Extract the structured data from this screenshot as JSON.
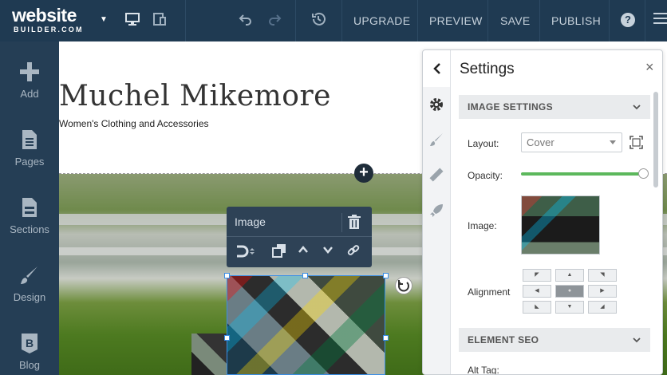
{
  "topbar": {
    "logo_line1": "website",
    "logo_line2": "BUILDER.COM",
    "upgrade_label": "UPGRADE",
    "preview_label": "PREVIEW",
    "save_label": "SAVE",
    "publish_label": "PUBLISH",
    "help_label": "?",
    "background_color": "#1f3a52"
  },
  "sidebar": {
    "items": [
      {
        "label": "Add",
        "icon": "plus-icon"
      },
      {
        "label": "Pages",
        "icon": "page-icon"
      },
      {
        "label": "Sections",
        "icon": "sections-icon"
      },
      {
        "label": "Design",
        "icon": "brush-icon"
      },
      {
        "label": "Blog",
        "icon": "blog-icon"
      }
    ]
  },
  "canvas": {
    "site_title": "Muchel Mikemore",
    "site_subtitle": "Women's Clothing and Accessories",
    "add_section_label": "+"
  },
  "image_toolbar": {
    "title": "Image"
  },
  "settings_panel": {
    "title": "Settings",
    "close_label": "×",
    "image_section_title": "IMAGE SETTINGS",
    "layout_label": "Layout:",
    "layout_value": "Cover",
    "opacity_label": "Opacity:",
    "opacity_value": 1.0,
    "image_label": "Image:",
    "alignment_label": "Alignment",
    "alignment_options": [
      "◤",
      "▲",
      "◥",
      "◀",
      "●",
      "▶",
      "◣",
      "▼",
      "◢"
    ],
    "alignment_selected_index": 4,
    "seo_section_title": "ELEMENT SEO",
    "alt_tag_label": "Alt Tag:",
    "accent_color": "#5cb85c"
  }
}
